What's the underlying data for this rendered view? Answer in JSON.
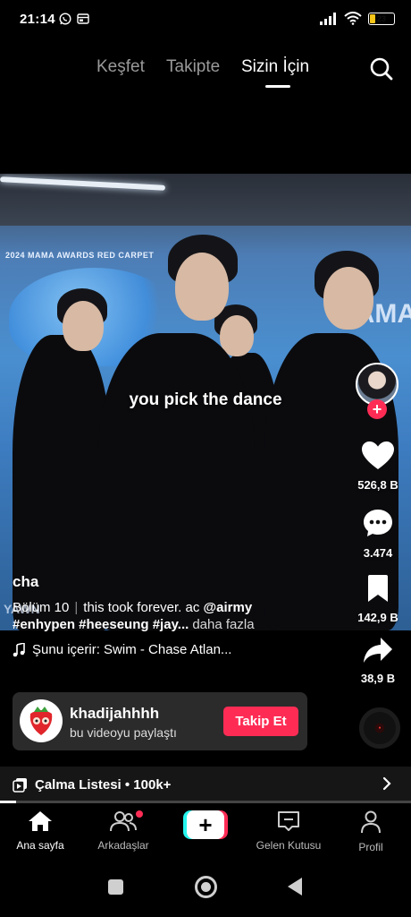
{
  "status_bar": {
    "time": "21:14",
    "battery_level": "23",
    "battery_fraction": 0.23,
    "icons": [
      "whatsapp-icon",
      "notification-icon",
      "signal-icon",
      "wifi-icon",
      "battery-icon"
    ]
  },
  "top_tabs": {
    "items": [
      {
        "label": "Keşfet",
        "active": false
      },
      {
        "label": "Takipte",
        "active": false
      },
      {
        "label": "Sizin İçin",
        "active": true
      }
    ],
    "search_icon": "search-icon"
  },
  "video": {
    "overlay_text": "you pick the dance",
    "backdrop_text": "2024 MAMA AWARDS RED CARPET",
    "backdrop_brand": "MAMA",
    "partial_text": "YAWN"
  },
  "actions": {
    "like_count": "526,8 B",
    "comment_count": "3.474",
    "save_count": "142,9 B",
    "share_count": "38,9 B",
    "follow_plus": "+"
  },
  "caption": {
    "username": "cha",
    "line1_prefix": "Bölüm 10",
    "line1_text": "this took forever. ac",
    "line1_mention": "@airmy",
    "hashtags": "#enhypen #heeseung #jay...",
    "more_label": "daha fazla",
    "music_text": "Şunu içerir: Swim - Chase Atlan..."
  },
  "shared_card": {
    "name": "khadijahhhh",
    "subtitle": "bu videoyu paylaştı",
    "follow_label": "Takip Et"
  },
  "playlist": {
    "label": "Çalma Listesi • 100k+",
    "progress_fraction": 0.04
  },
  "bottom_nav": {
    "items": [
      {
        "label": "Ana sayfa",
        "icon": "home-icon",
        "active": true
      },
      {
        "label": "Arkadaşlar",
        "icon": "friends-icon",
        "active": false
      },
      {
        "label": "Gelen Kutusu",
        "icon": "inbox-icon",
        "active": false
      },
      {
        "label": "Profil",
        "icon": "profile-icon",
        "active": false
      }
    ],
    "create_label": "+"
  },
  "colors": {
    "accent": "#fe2c55",
    "cyan": "#25f4ee",
    "background": "#000000"
  }
}
